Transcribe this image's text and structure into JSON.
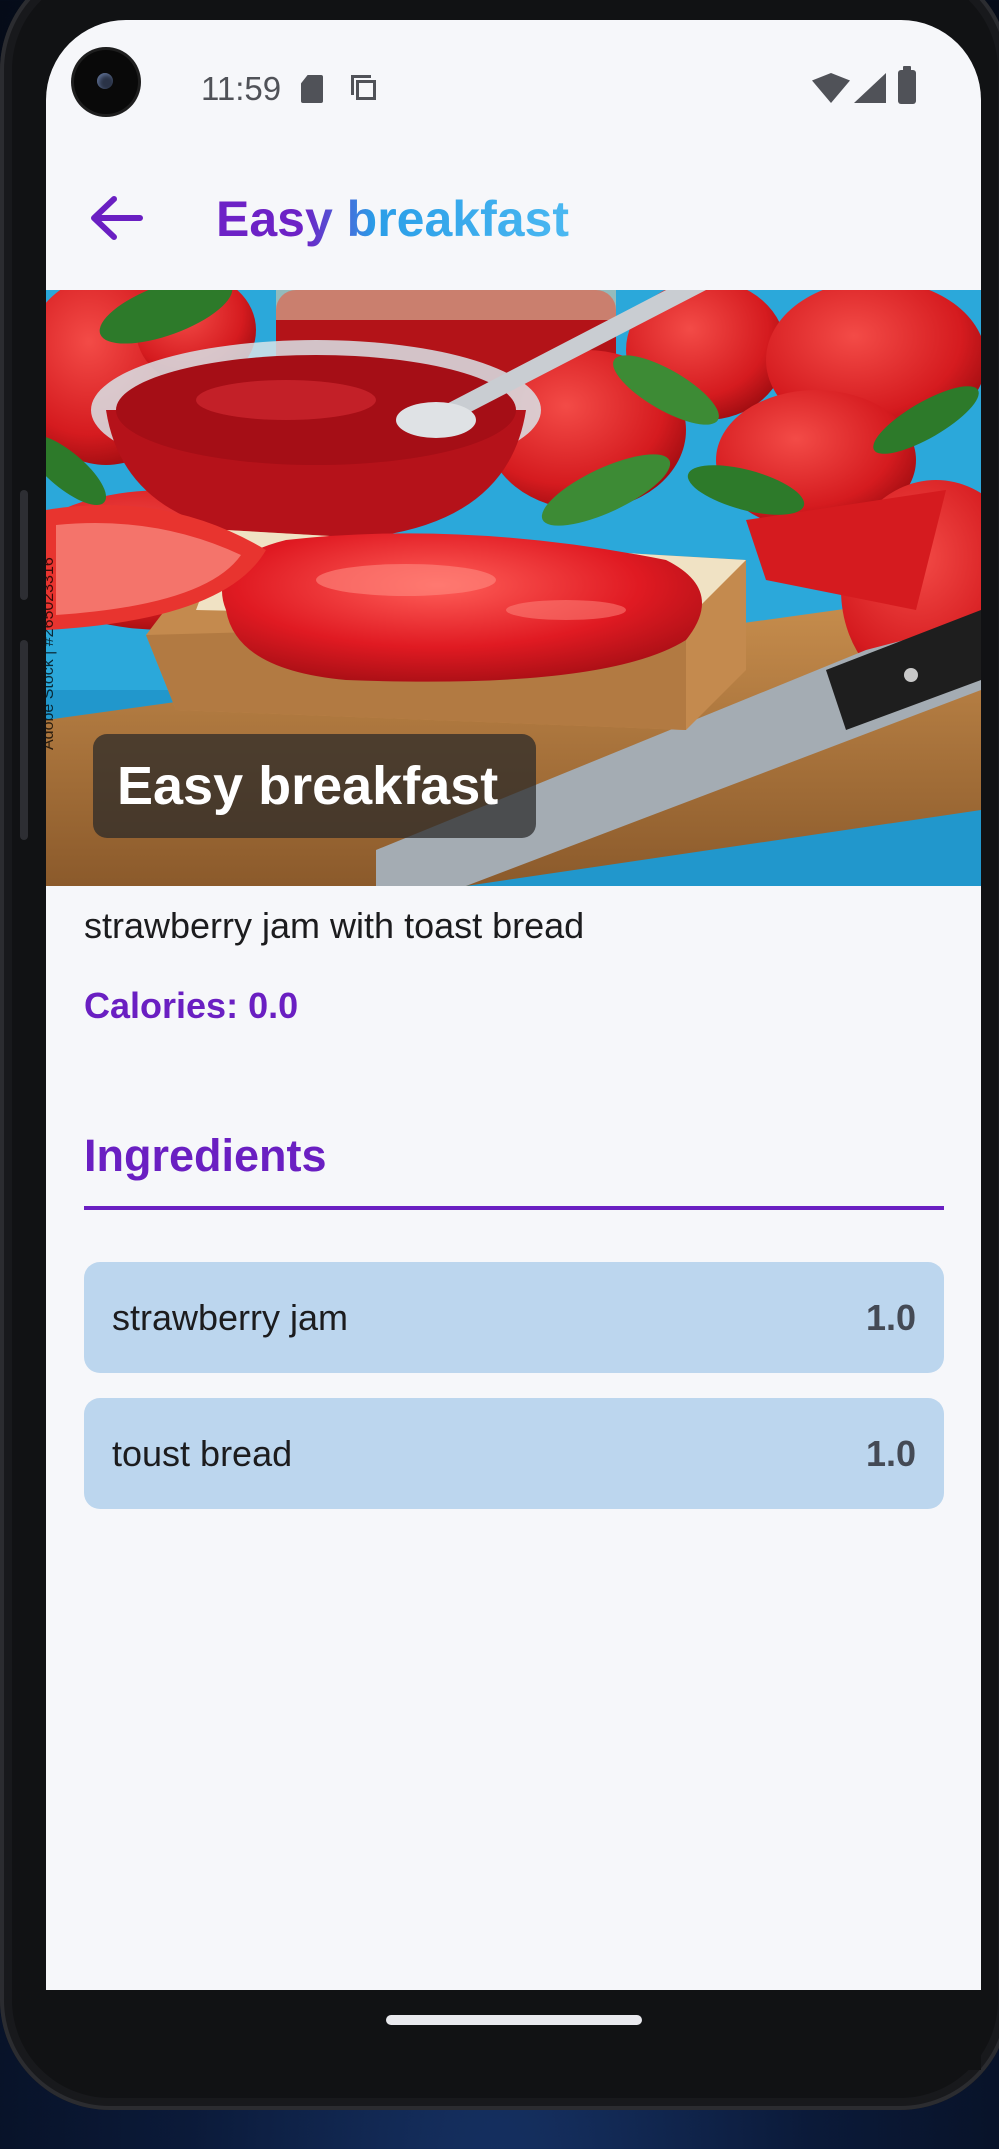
{
  "status_bar": {
    "time": "11:59",
    "icons": [
      "camera-cutout",
      "sd-card-icon",
      "copy-icon",
      "wifi-icon",
      "signal-icon",
      "battery-icon"
    ]
  },
  "app_bar": {
    "title": "Easy breakfast",
    "back_icon": "arrow-left-icon"
  },
  "hero": {
    "overlay_title": "Easy breakfast",
    "watermark": "Adobe Stock | #265023316"
  },
  "recipe": {
    "description": "strawberry jam with toast bread",
    "calories_label": "Calories:",
    "calories_value": "0.0"
  },
  "ingredients": {
    "heading": "Ingredients",
    "items": [
      {
        "name": "strawberry jam",
        "quantity": "1.0"
      },
      {
        "name": "toust bread",
        "quantity": "1.0"
      }
    ]
  },
  "colors": {
    "accent": "#6a1fc2",
    "title_gradient_end": "#4bb8f1",
    "ingredient_card": "#bcd6ee",
    "background": "#f6f7fa"
  }
}
